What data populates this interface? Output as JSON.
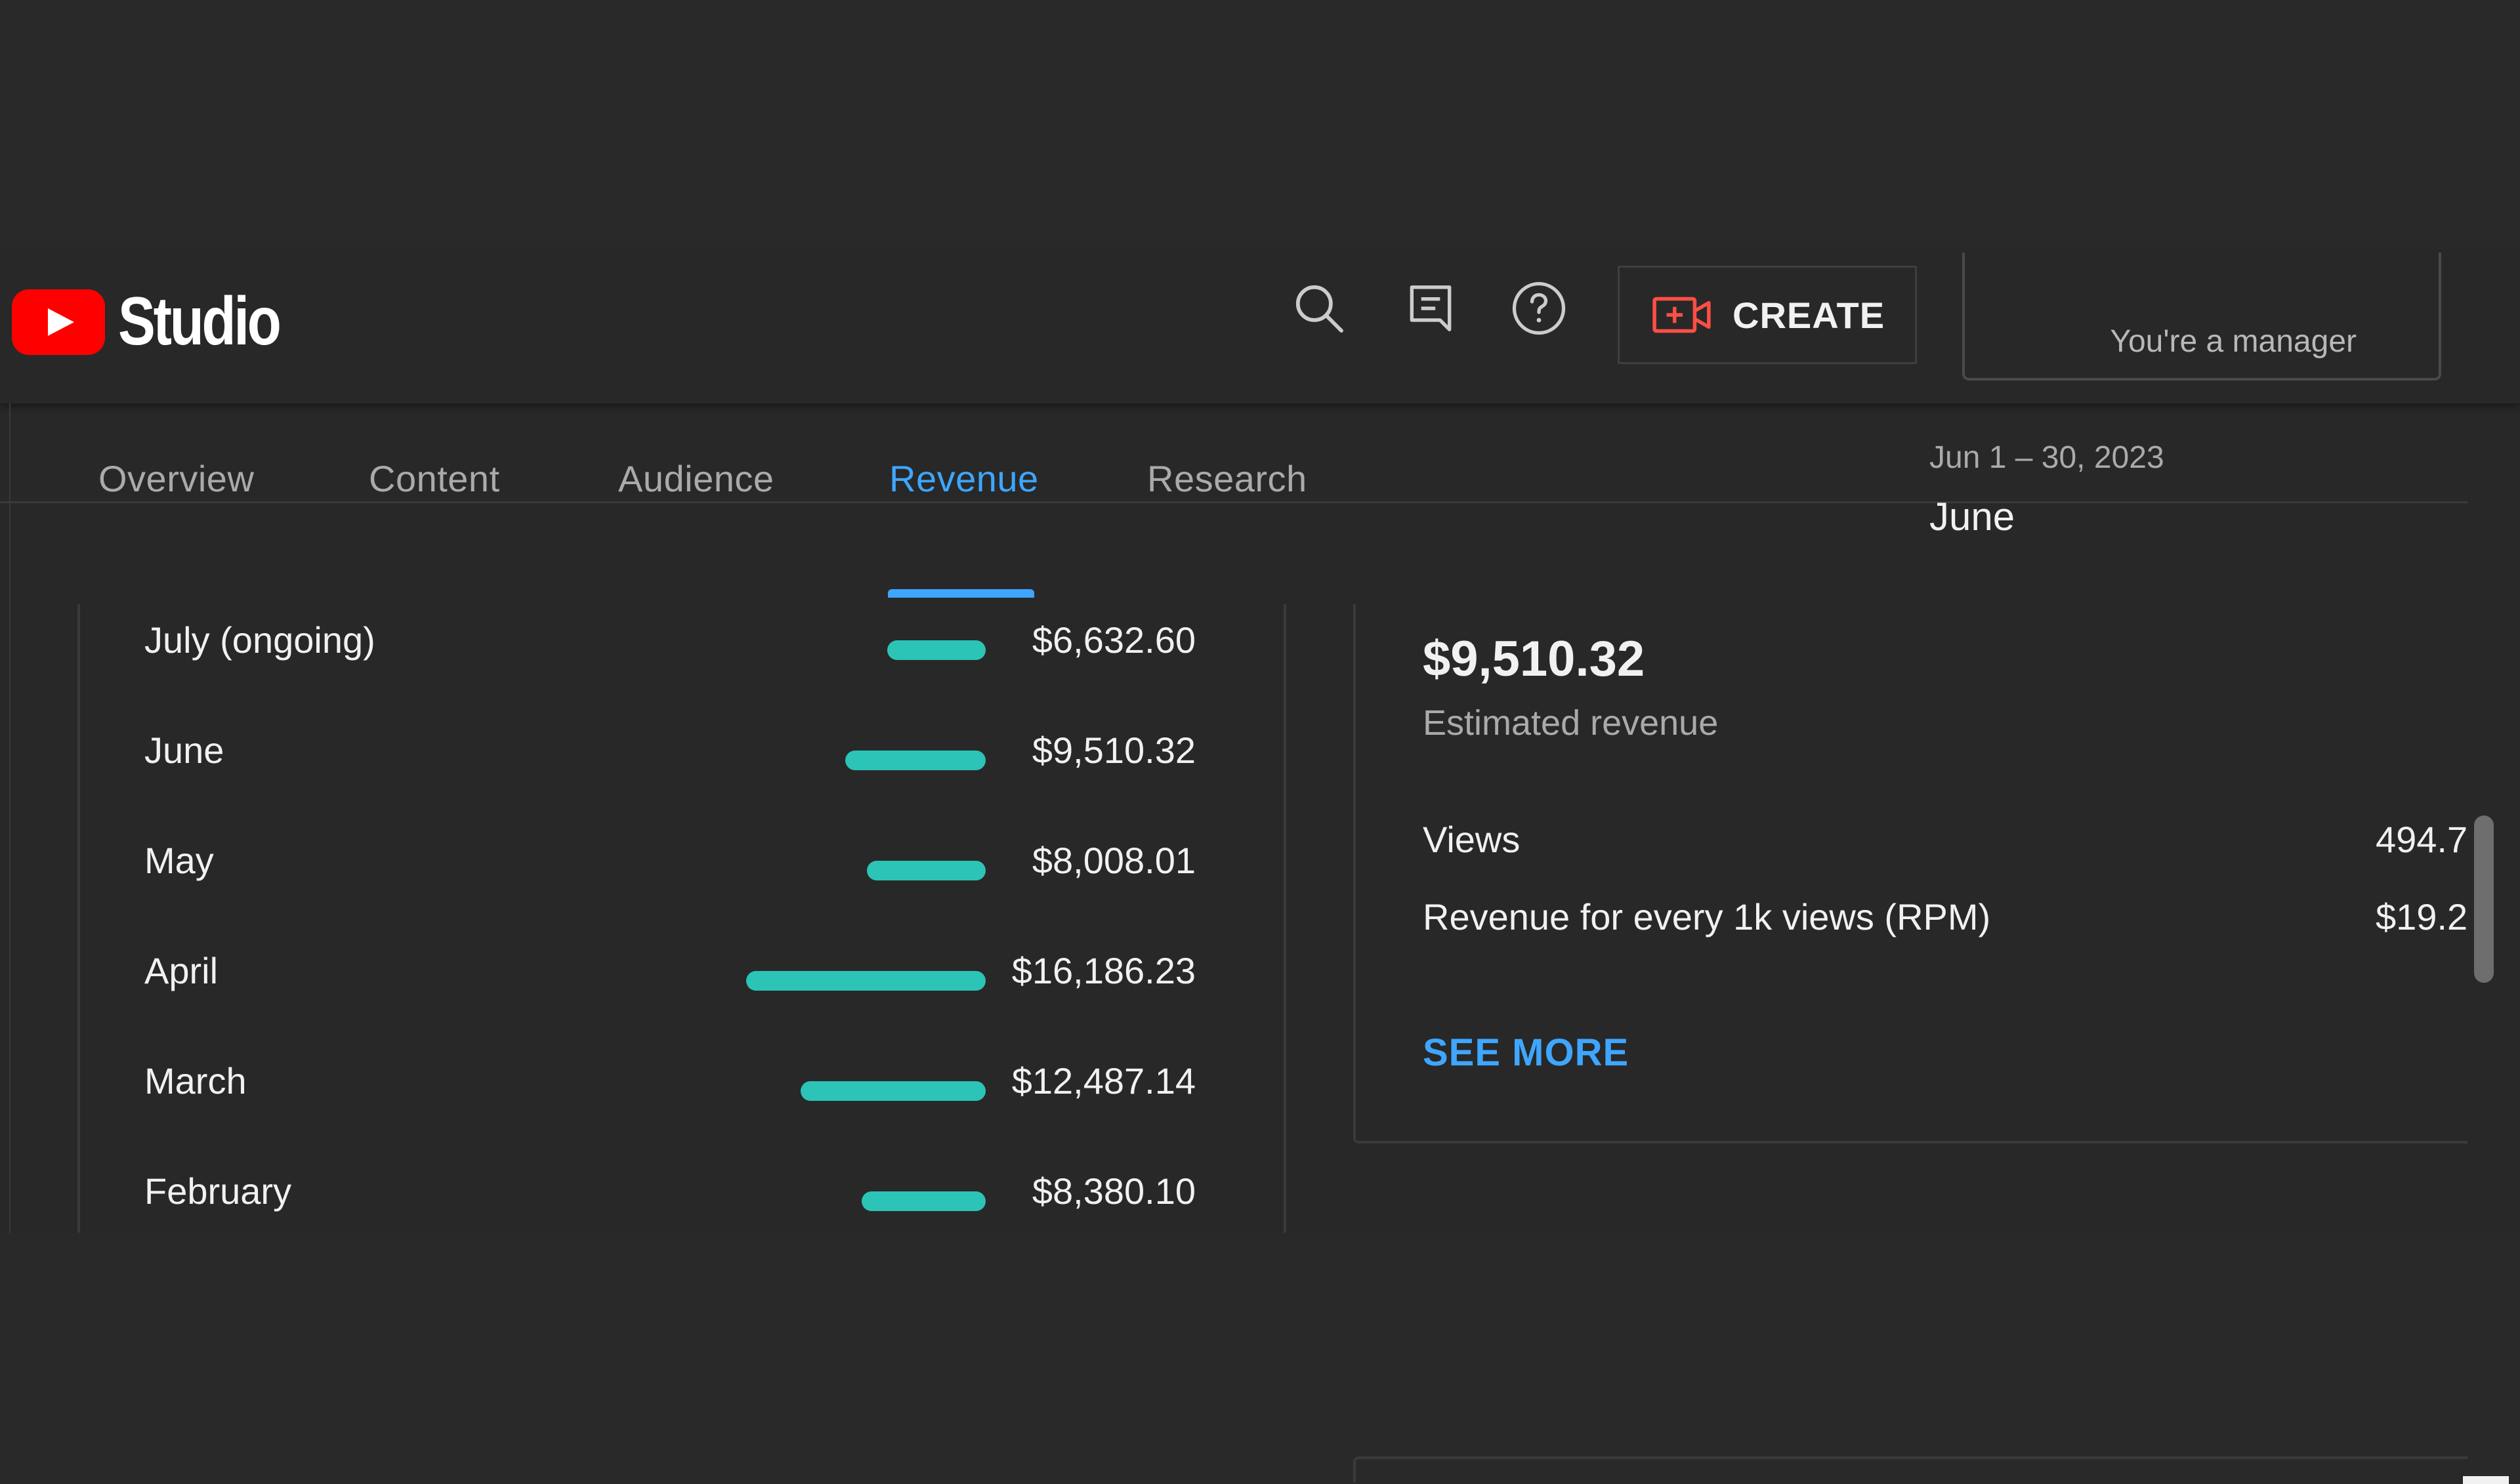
{
  "header": {
    "brand": "Studio",
    "create_label": "CREATE",
    "account_label": "You're a manager",
    "icons": [
      "search-icon",
      "feedback-icon",
      "help-icon",
      "create-video-icon"
    ]
  },
  "tabs": [
    {
      "label": "Overview",
      "active": false
    },
    {
      "label": "Content",
      "active": false
    },
    {
      "label": "Audience",
      "active": false
    },
    {
      "label": "Revenue",
      "active": true
    },
    {
      "label": "Research",
      "active": false
    }
  ],
  "period": {
    "date_range": "Jun 1 – 30, 2023",
    "label": "June"
  },
  "months": [
    {
      "label": "July (ongoing)",
      "value": "$6,632.60",
      "amount": 6632.6
    },
    {
      "label": "June",
      "value": "$9,510.32",
      "amount": 9510.32
    },
    {
      "label": "May",
      "value": "$8,008.01",
      "amount": 8008.01
    },
    {
      "label": "April",
      "value": "$16,186.23",
      "amount": 16186.23
    },
    {
      "label": "March",
      "value": "$12,487.14",
      "amount": 12487.14
    },
    {
      "label": "February",
      "value": "$8,380.10",
      "amount": 8380.1
    }
  ],
  "summary": {
    "revenue": "$9,510.32",
    "revenue_caption": "Estimated revenue",
    "metrics": [
      {
        "label": "Views",
        "value": "494.7"
      },
      {
        "label": "Revenue for every 1k views (RPM)",
        "value": "$19.2"
      }
    ],
    "see_more": "SEE MORE"
  },
  "colors": {
    "accent": "#3ea6ff",
    "bar": "#2bc4b6",
    "background": "#282828",
    "brand_red": "#ff0000"
  }
}
